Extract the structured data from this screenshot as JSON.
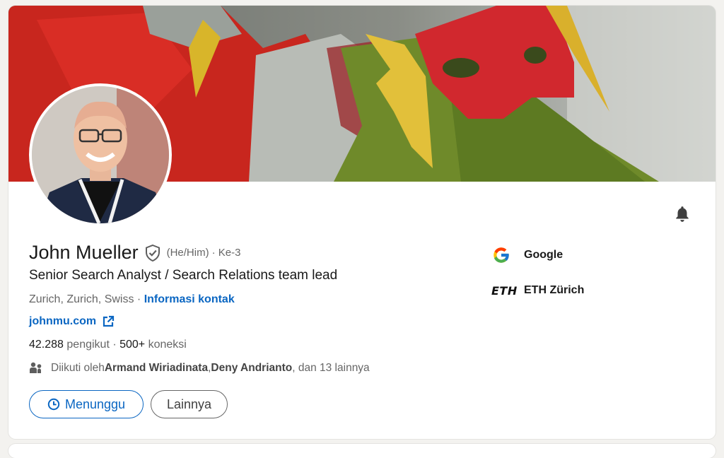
{
  "profile": {
    "name": "John Mueller",
    "pronouns": "(He/Him)",
    "degree": "· Ke-3",
    "headline": "Senior Search Analyst / Search Relations team lead",
    "location": "Zurich, Zurich, Swiss",
    "location_sep": " · ",
    "contact_label": "Informasi kontak",
    "website": "johnmu.com",
    "followers_count": "42.288",
    "followers_label": "pengikut",
    "connections_sep": " · ",
    "connections_count": "500+",
    "connections_label": "koneksi",
    "followed_prefix": "Diikuti oleh ",
    "followed_person1": "Armand Wiriadinata",
    "followed_comma": ", ",
    "followed_person2": "Deny Andrianto",
    "followed_suffix": ", dan 13 lainnya"
  },
  "actions": {
    "pending_label": "Menunggu",
    "more_label": "Lainnya"
  },
  "organizations": [
    {
      "name": "Google",
      "logo": "google-logo"
    },
    {
      "name": "ETH Zürich",
      "logo_text": "ETH"
    }
  ],
  "icons": {
    "bell": "bell-icon",
    "verified": "shield-check-icon",
    "external_link": "external-link-icon",
    "people": "people-icon",
    "clock": "clock-icon"
  },
  "colors": {
    "link": "#0a66c2",
    "text_primary": "#191919",
    "text_secondary": "#666666"
  }
}
